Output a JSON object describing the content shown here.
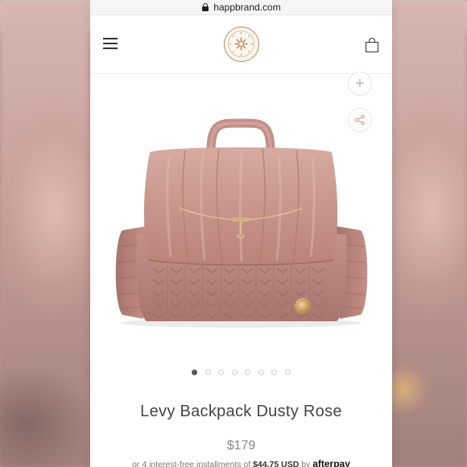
{
  "browser": {
    "url": "happbrand.com"
  },
  "header": {
    "menu_icon": "hamburger-menu-icon",
    "logo": "happ-brand-logo",
    "cart_icon": "shopping-bag-icon"
  },
  "gallery": {
    "zoom_icon": "plus-icon",
    "share_icon": "share-icon",
    "slide_count": 8,
    "active_slide": 1
  },
  "product": {
    "title": "Levy Backpack Dusty Rose",
    "price": "$179",
    "installments_prefix": "or 4 interest-free installments of",
    "installment_amount": "$44.75 USD",
    "installments_by": "by",
    "provider": "afterpay"
  },
  "colors": {
    "product_rose": "#c99890",
    "logo_gold": "#b98a55",
    "text": "#444444"
  }
}
